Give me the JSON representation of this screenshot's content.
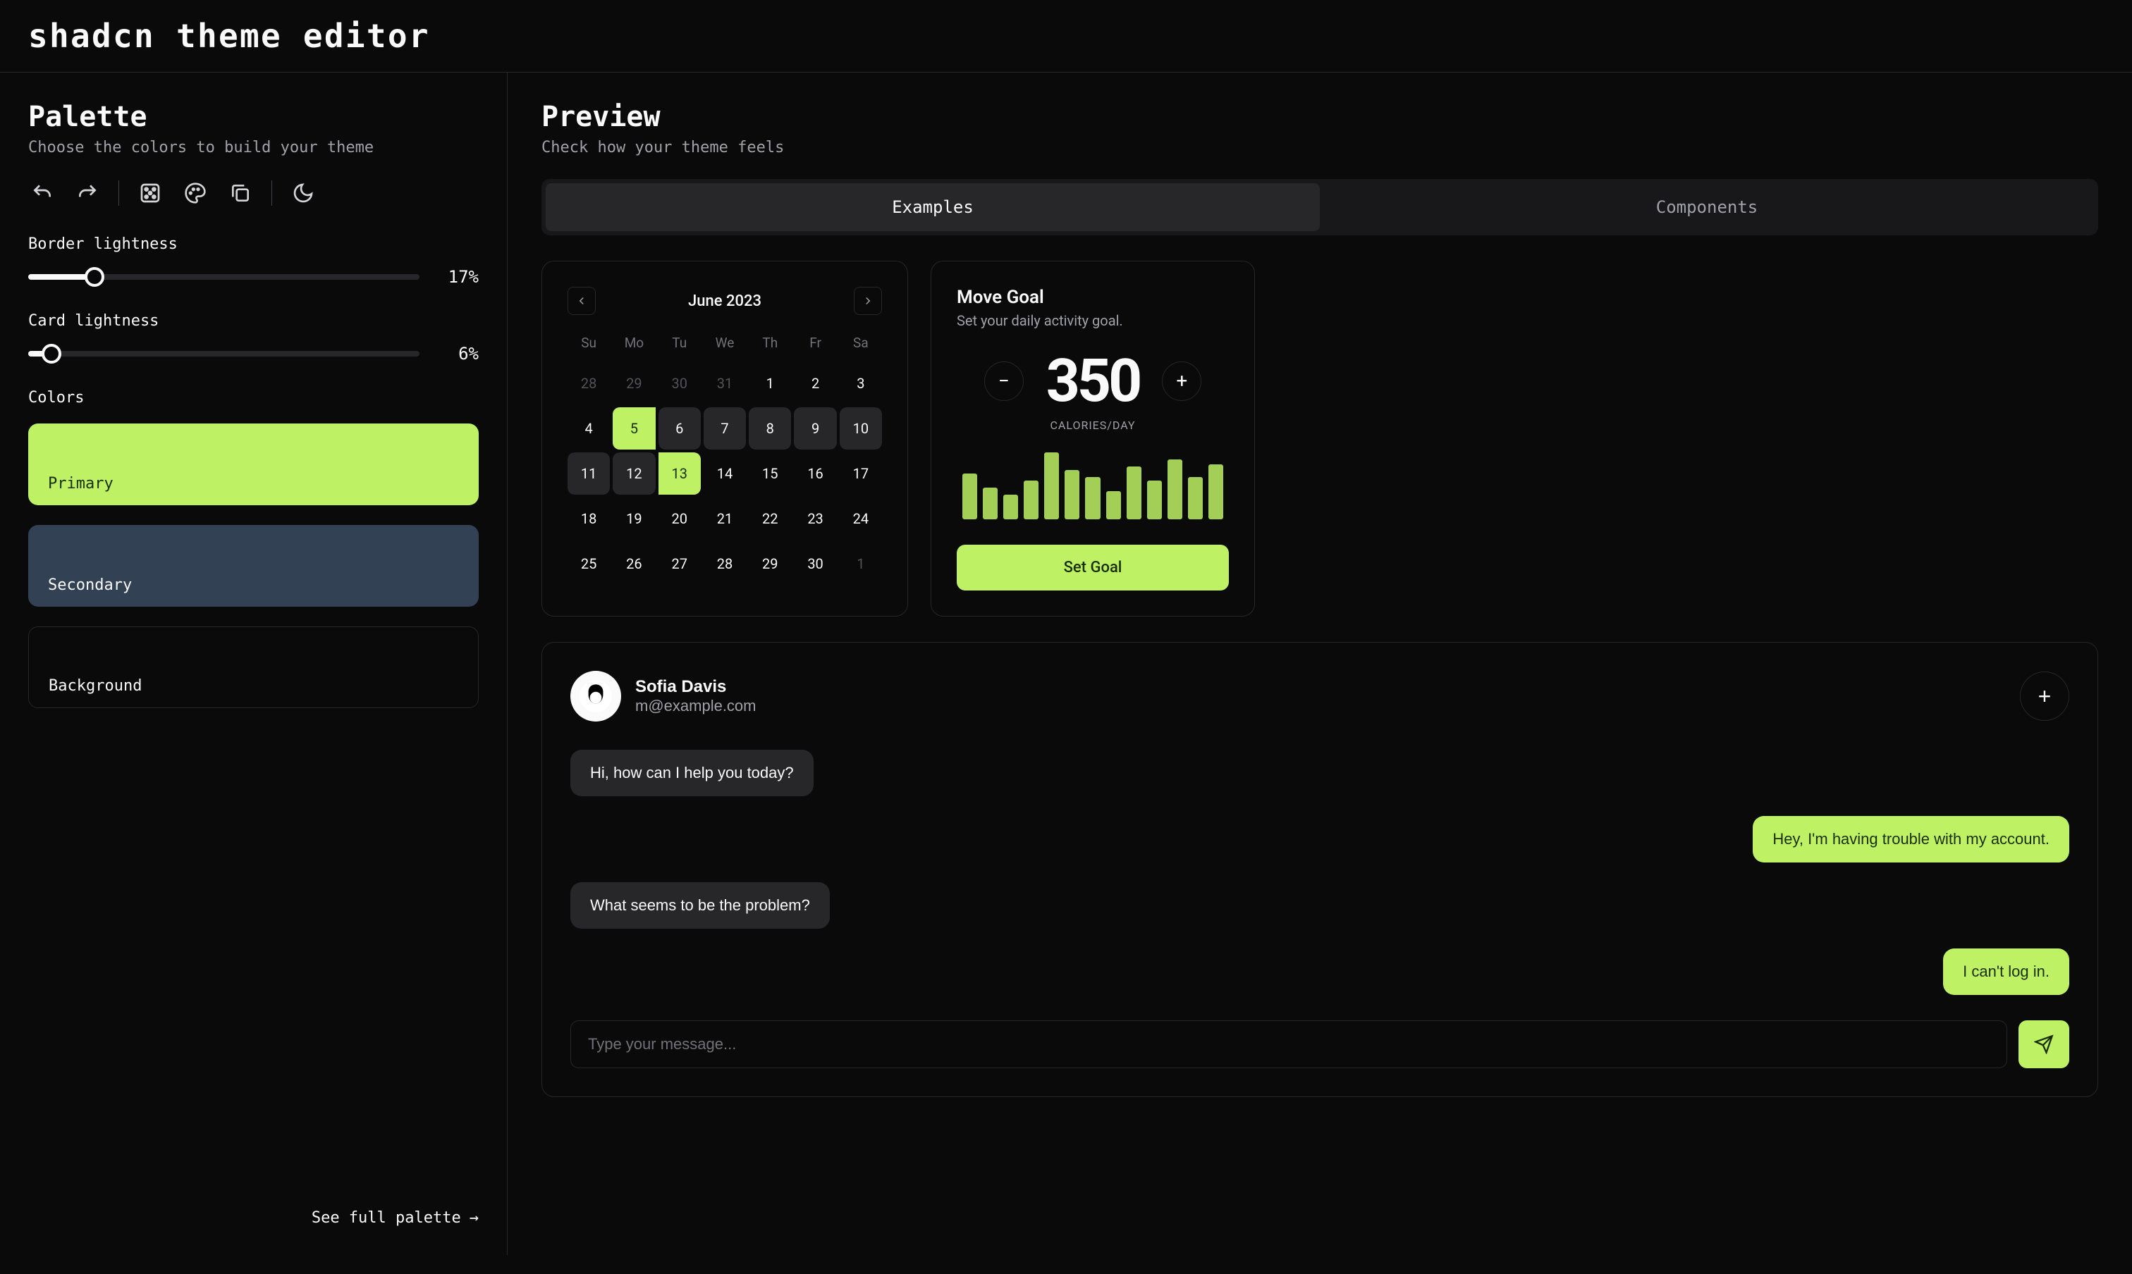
{
  "app_title": "shadcn theme editor",
  "sidebar": {
    "heading": "Palette",
    "sub": "Choose the colors to build your theme",
    "border_lightness_label": "Border lightness",
    "border_lightness_value": "17%",
    "border_lightness_pct": 17,
    "card_lightness_label": "Card lightness",
    "card_lightness_value": "6%",
    "card_lightness_pct": 6,
    "colors_label": "Colors",
    "swatches": [
      {
        "label": "Primary",
        "hex": "#bef264"
      },
      {
        "label": "Secondary",
        "hex": "#334155"
      },
      {
        "label": "Background",
        "hex": "#0a0a0a"
      }
    ],
    "see_full": "See full palette"
  },
  "preview": {
    "heading": "Preview",
    "sub": "Check how your theme feels",
    "tabs": {
      "examples": "Examples",
      "components": "Components",
      "active": "examples"
    }
  },
  "calendar": {
    "title": "June 2023",
    "dow": [
      "Su",
      "Mo",
      "Tu",
      "We",
      "Th",
      "Fr",
      "Sa"
    ],
    "days": [
      {
        "n": "28",
        "m": true
      },
      {
        "n": "29",
        "m": true
      },
      {
        "n": "30",
        "m": true
      },
      {
        "n": "31",
        "m": true
      },
      {
        "n": "1"
      },
      {
        "n": "2"
      },
      {
        "n": "3"
      },
      {
        "n": "4"
      },
      {
        "n": "5",
        "rs": true
      },
      {
        "n": "6",
        "ir": true
      },
      {
        "n": "7",
        "ir": true
      },
      {
        "n": "8",
        "ir": true
      },
      {
        "n": "9",
        "ir": true
      },
      {
        "n": "10",
        "ir": true
      },
      {
        "n": "11",
        "ir": true
      },
      {
        "n": "12",
        "ir": true
      },
      {
        "n": "13",
        "re": true
      },
      {
        "n": "14"
      },
      {
        "n": "15"
      },
      {
        "n": "16"
      },
      {
        "n": "17"
      },
      {
        "n": "18"
      },
      {
        "n": "19"
      },
      {
        "n": "20"
      },
      {
        "n": "21"
      },
      {
        "n": "22"
      },
      {
        "n": "23"
      },
      {
        "n": "24"
      },
      {
        "n": "25"
      },
      {
        "n": "26"
      },
      {
        "n": "27"
      },
      {
        "n": "28"
      },
      {
        "n": "29"
      },
      {
        "n": "30"
      },
      {
        "n": "1",
        "m": true
      }
    ]
  },
  "move_goal": {
    "title": "Move Goal",
    "sub": "Set your daily activity goal.",
    "value": "350",
    "unit": "CALORIES/DAY",
    "bars": [
      65,
      45,
      35,
      55,
      95,
      70,
      60,
      40,
      75,
      55,
      85,
      60,
      78
    ],
    "button": "Set Goal"
  },
  "chat": {
    "name": "Sofia Davis",
    "email": "m@example.com",
    "messages": [
      {
        "who": "them",
        "text": "Hi, how can I help you today?"
      },
      {
        "who": "me",
        "text": "Hey, I'm having trouble with my account."
      },
      {
        "who": "them",
        "text": "What seems to be the problem?"
      },
      {
        "who": "me",
        "text": "I can't log in."
      }
    ],
    "placeholder": "Type your message..."
  }
}
